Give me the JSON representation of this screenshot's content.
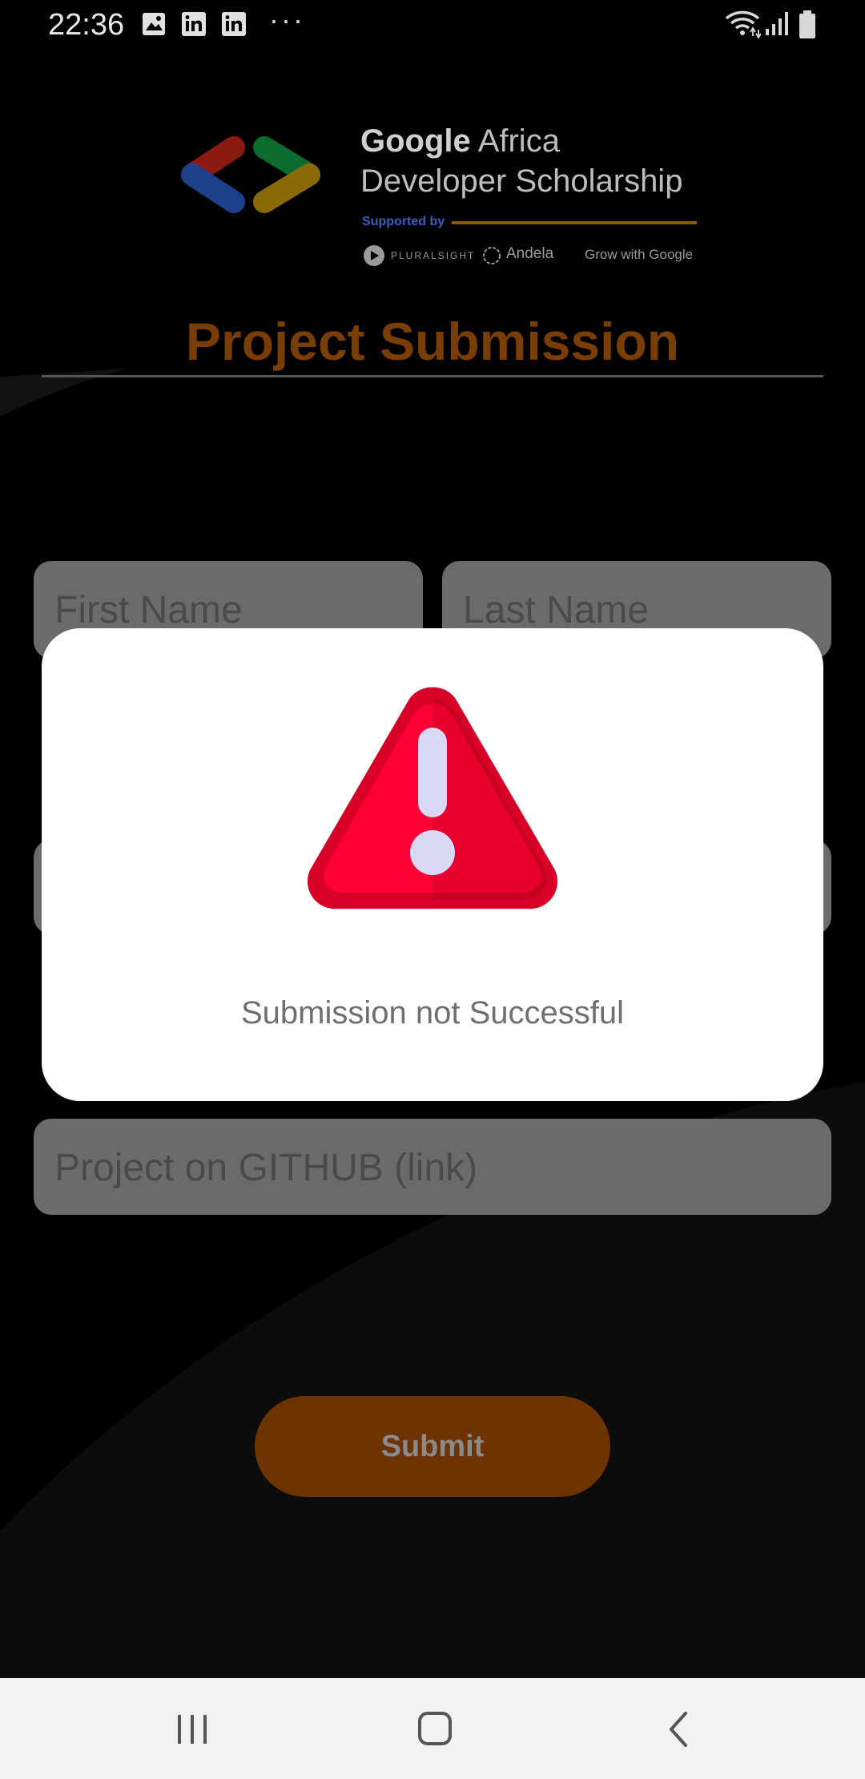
{
  "status_bar": {
    "time": "22:36",
    "notification_icons": [
      "image-icon",
      "linkedin-icon",
      "linkedin-icon"
    ],
    "more": "···",
    "right_icons": [
      "wifi-icon",
      "signal-icon",
      "battery-icon"
    ]
  },
  "logo": {
    "line1_bold": "Google",
    "line1_rest": " Africa",
    "line2": "Developer Scholarship",
    "supported_by": "Supported by",
    "partners": [
      "PLURALSIGHT",
      "Andela",
      "Grow with Google"
    ]
  },
  "page": {
    "title": "Project Submission"
  },
  "form": {
    "first_name_placeholder": "First Name",
    "last_name_placeholder": "Last Name",
    "github_placeholder": "Project on GITHUB (link)",
    "submit_label": "Submit"
  },
  "dialog": {
    "icon": "warning-icon",
    "message": "Submission not Successful"
  },
  "nav_bar": {
    "buttons": [
      "recent-apps-icon",
      "home-icon",
      "back-icon"
    ]
  },
  "colors": {
    "title_orange": "#7a3d06",
    "submit_brown": "#6e3300",
    "warning_red": "#f0002d"
  }
}
